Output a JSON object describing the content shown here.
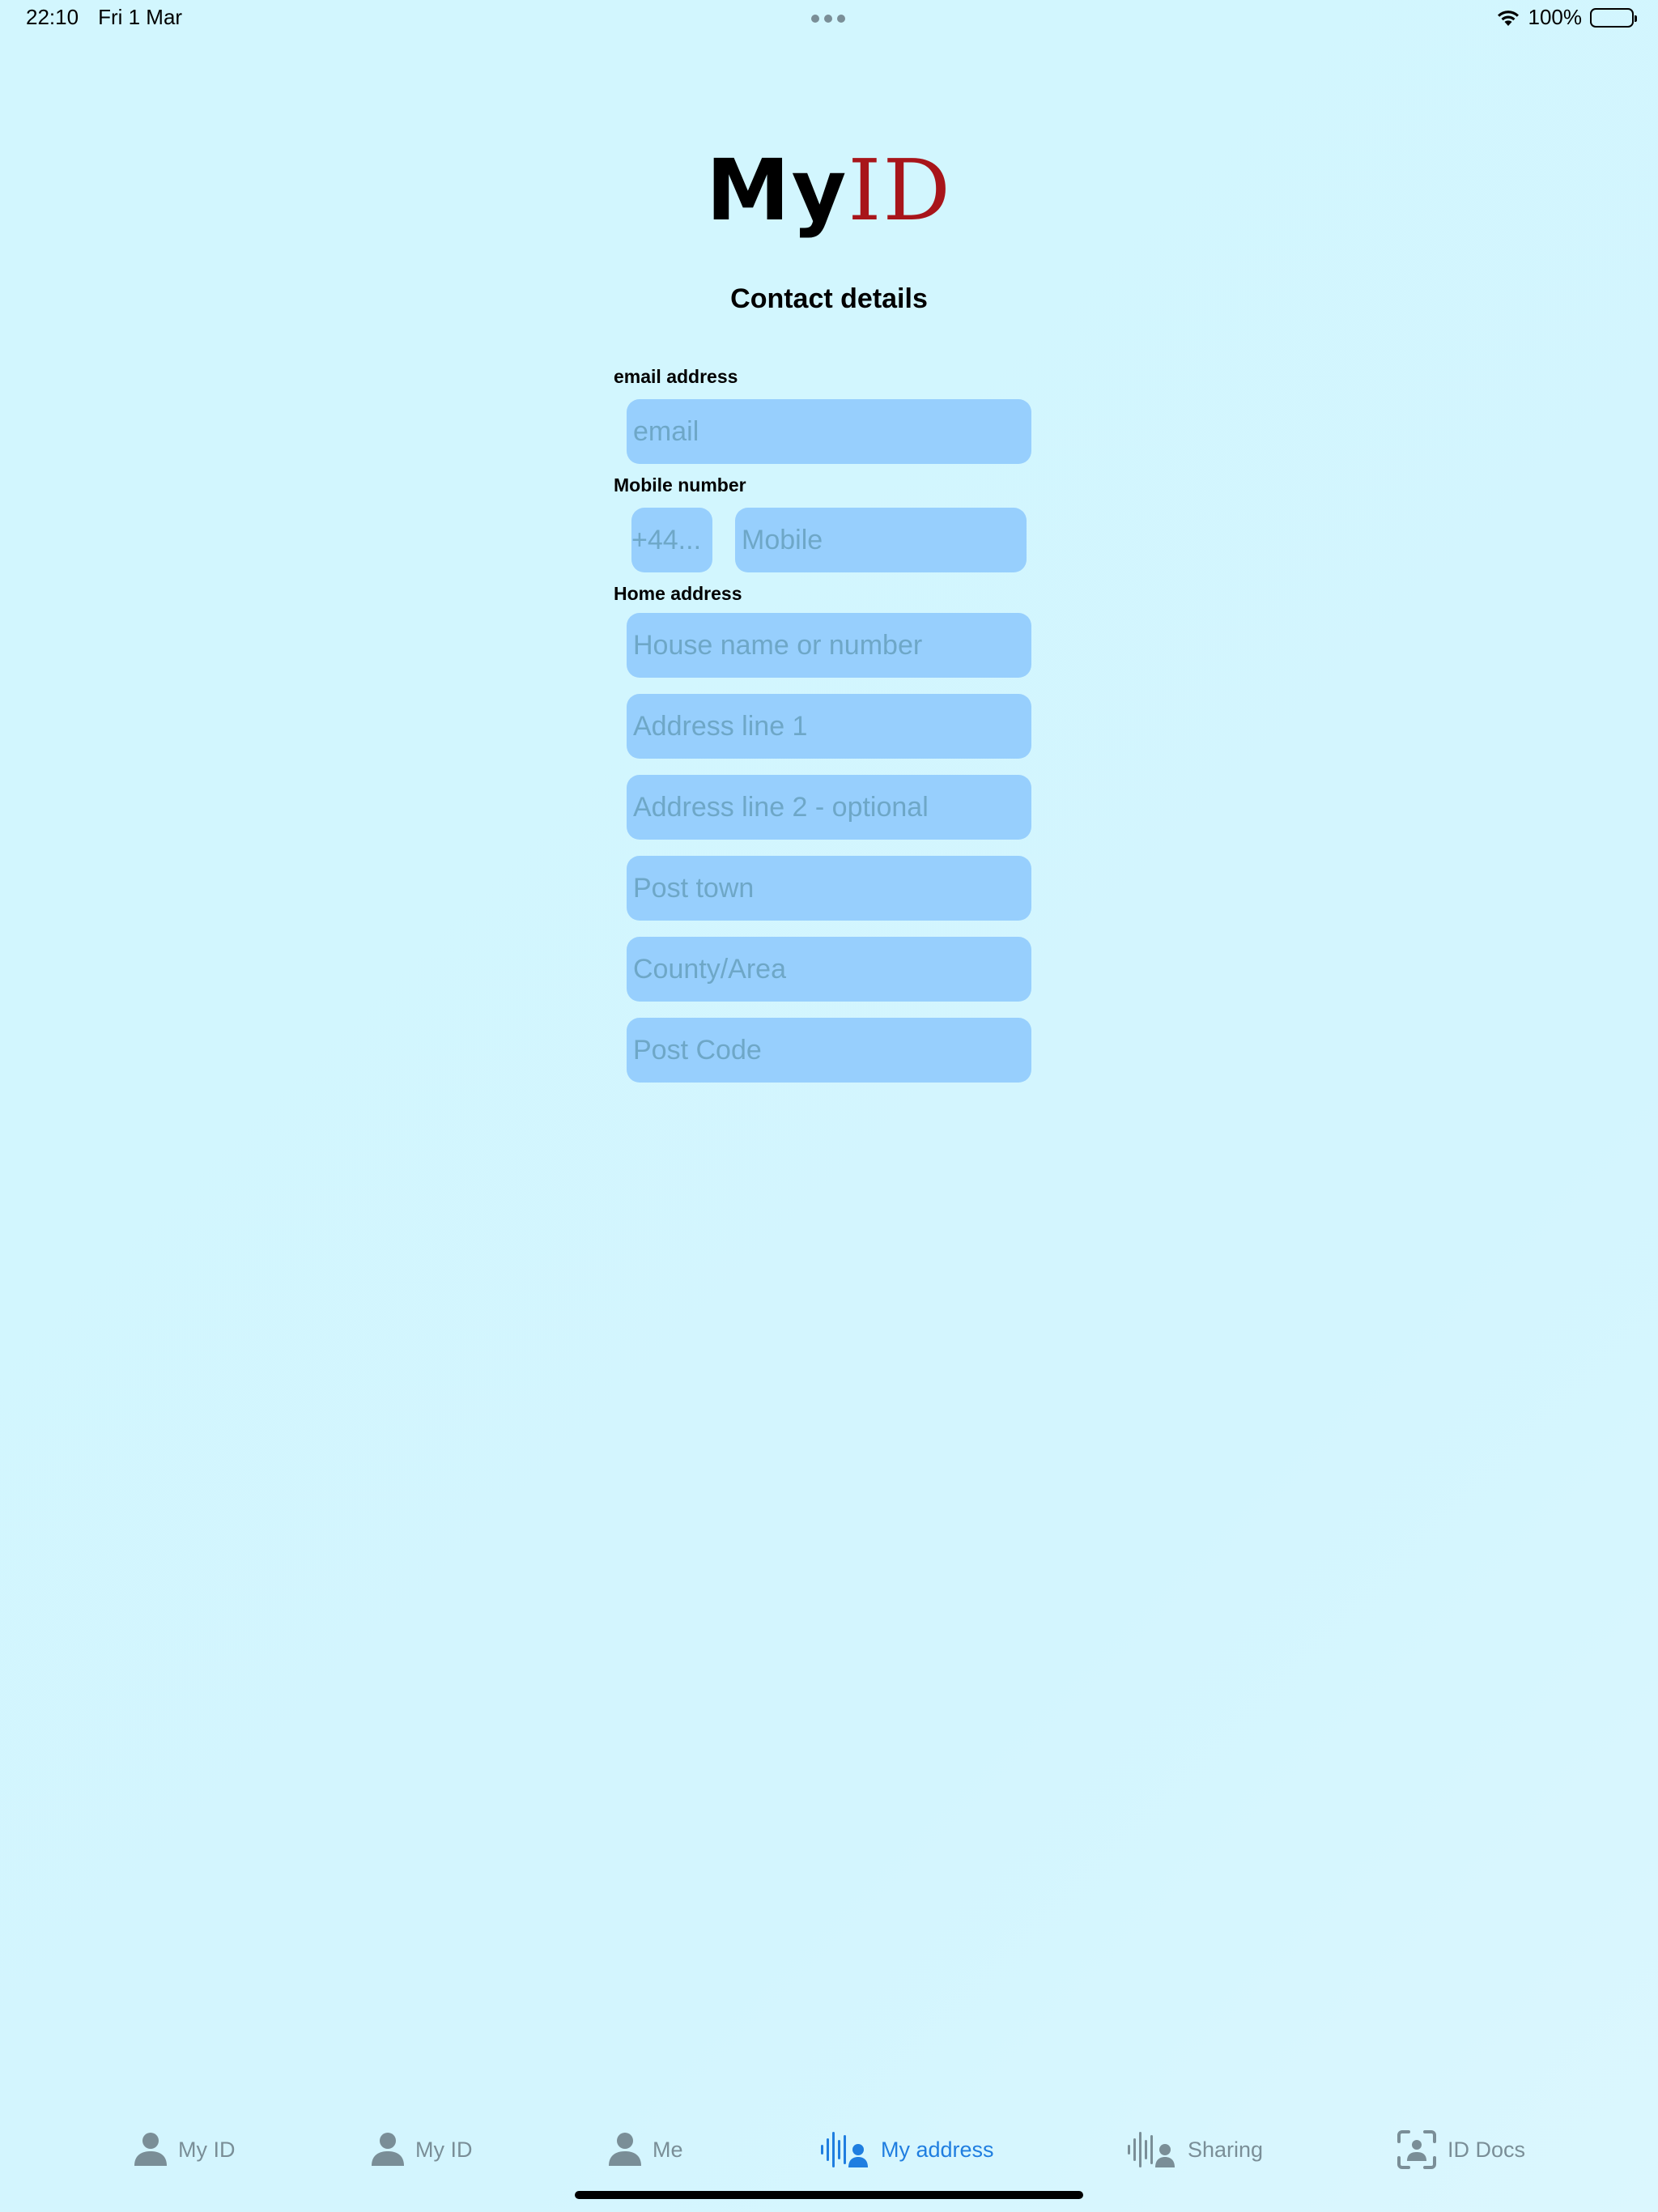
{
  "status_bar": {
    "time": "22:10",
    "date": "Fri 1 Mar",
    "battery": "100%"
  },
  "logo": {
    "part1": "My",
    "part2": "ID",
    "part2_color": "#a8151a"
  },
  "title": "Contact details",
  "email": {
    "label": "email address",
    "placeholder": "email"
  },
  "mobile": {
    "label": "Mobile number",
    "code_placeholder": "+44...",
    "number_placeholder": "Mobile"
  },
  "address": {
    "label": "Home address",
    "house_placeholder": "House name or number",
    "line1_placeholder": "Address line 1",
    "line2_placeholder": "Address line 2 - optional",
    "town_placeholder": "Post town",
    "county_placeholder": "County/Area",
    "postcode_placeholder": "Post Code"
  },
  "tabs": [
    {
      "label": "My ID",
      "icon": "person-icon",
      "active": false
    },
    {
      "label": "My ID",
      "icon": "person-icon",
      "active": false
    },
    {
      "label": "Me",
      "icon": "person-icon",
      "active": false
    },
    {
      "label": "My address",
      "icon": "voice-person-icon",
      "active": true
    },
    {
      "label": "Sharing",
      "icon": "voice-person-icon",
      "active": false
    },
    {
      "label": "ID Docs",
      "icon": "person-viewfinder-icon",
      "active": false
    }
  ],
  "colors": {
    "background": "#d3f5fe",
    "field_fill": "#97cffd",
    "active_tab": "#1f7ee0",
    "inactive_tab": "#7a8e97"
  }
}
